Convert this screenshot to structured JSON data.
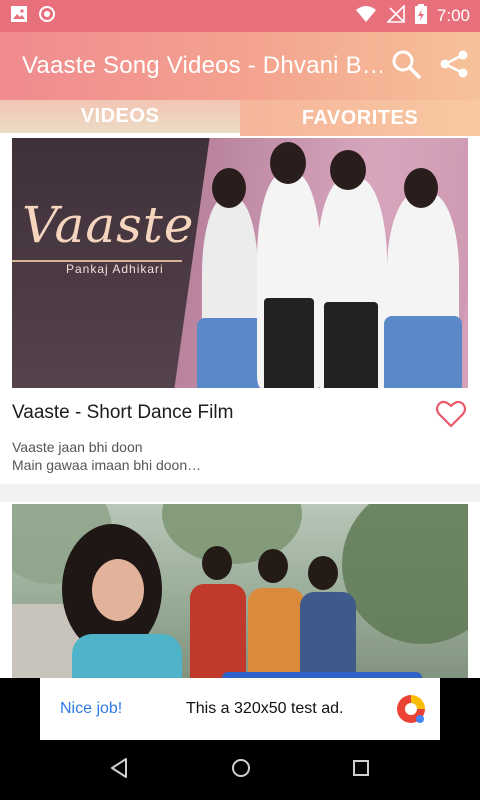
{
  "status_bar": {
    "time": "7:00",
    "left_icons": [
      "image-icon",
      "record-icon"
    ],
    "right_icons": [
      "wifi-icon",
      "no-signal-icon",
      "battery-charging-icon"
    ]
  },
  "app_bar": {
    "title": "Vaaste Song Videos - Dhvani B…",
    "actions": [
      "search-icon",
      "share-icon"
    ]
  },
  "tabs": [
    {
      "label": "VIDEOS",
      "selected": true
    },
    {
      "label": "FAVORITES",
      "selected": false
    }
  ],
  "videos": [
    {
      "title": "Vaaste - Short Dance Film",
      "desc_line1": "Vaaste jaan bhi doon",
      "desc_line2": "Main gawaa imaan bhi doon…",
      "thumb_logo": "Vaaste",
      "thumb_sub": "Pankaj Adhikari"
    },
    {
      "title": "",
      "desc_line1": "",
      "desc_line2": ""
    }
  ],
  "ad": {
    "nice_job": "Nice job!",
    "text": "This a 320x50 test ad."
  },
  "nav": [
    "back-icon",
    "home-icon",
    "recents-icon"
  ],
  "colors": {
    "accent": "#f08a8f",
    "ad_link": "#2f7be6"
  }
}
